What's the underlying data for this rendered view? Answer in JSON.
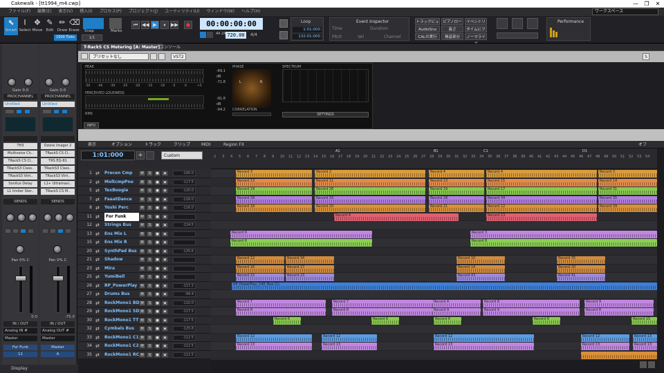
{
  "app": {
    "title": "Cakewalk - [tt1994_m4.cwp]",
    "minimize": "—",
    "maximize": "❐",
    "close": "✕"
  },
  "menu": [
    "ファイル(F)",
    "編集(E)",
    "表示(V)",
    "挿入(I)",
    "プロセス(P)",
    "プロジェクト(J)",
    "ユーティリティ(U)",
    "ウィンドウ(W)",
    "ヘルプ(H)"
  ],
  "workspace": "ワークスペース",
  "tools": [
    {
      "label": "Smart",
      "icon": "⬉"
    },
    {
      "label": "Select",
      "icon": "I"
    },
    {
      "label": "Move",
      "icon": "✥"
    },
    {
      "label": "Edit",
      "icon": "✎"
    },
    {
      "label": "Draw",
      "icon": "✏"
    },
    {
      "label": "Erase",
      "icon": "⌫"
    }
  ],
  "snap": {
    "label": "Snap",
    "value": "1/1",
    "ticks": "1500 Ticks"
  },
  "marks": {
    "label": "Marks"
  },
  "transport": {
    "time": "00:00:00:00",
    "tempo": "720.00",
    "meter": "4/4",
    "sig": "44 24"
  },
  "loop": {
    "label": "Loop",
    "start": "1:01:000",
    "end": "132:01:000"
  },
  "inspector": {
    "title": "Event Inspector",
    "cols": [
      "Time",
      "Duration"
    ],
    "cols2": [
      "Pitch",
      "Vel",
      "Channel"
    ]
  },
  "jump_buttons": [
    "トラックビュー",
    "ピアノロー",
    "イベントリ",
    "AudioSna",
    "長さ",
    "タイムにフ",
    "CALの実行",
    "無音部分",
    "ノーマライズ"
  ],
  "performance": {
    "label": "Performance"
  },
  "strips": [
    {
      "gain": "Gain 0.0",
      "pan": "Pan",
      "pc": "PROCHANNEL",
      "preset": "Untitled",
      "fx": [
        "TH3",
        "Multivoice Ch..",
        "TRackS CS Cl..",
        "TRackS3 Class..",
        "TRackS3 Vint..",
        "Sonitus Delay",
        "L1 limiter Ster.."
      ],
      "sends": "SENDS",
      "panval": "Pan 0% C",
      "io": "IN / OUT",
      "in": "Analog IN #",
      "out": "Master",
      "name": "For Funk",
      "num": "11",
      "vol": "0.0"
    },
    {
      "gain": "Gain 0.0",
      "pan": "Pan",
      "pc": "PROCHANNEL",
      "preset": "Untitled",
      "fx": [
        "Ozone Imager 2",
        "TRackS CS Cl..",
        "TRS EQ-81",
        "TRackS3 Class..",
        "TRackS3 Vint..",
        "L1+ Ultramaxi..",
        "TRackS CS M.."
      ],
      "sends": "SENDS",
      "panval": "Pan 0% C",
      "io": "IN / OUT",
      "in": "Analog OUT #",
      "out": "Master",
      "name": "Master",
      "num": "A",
      "vol": "-75.0"
    }
  ],
  "display_label": "Display",
  "tabs": [
    "T-RackS CS Metering [A: Master]",
    "コンソール"
  ],
  "plugin": {
    "preset": "プリセットなし",
    "format": "VST2",
    "peak": "PEAK",
    "loud": "PERCEIVED LOUDNESS",
    "rms": "RMS",
    "phase": "PHASE",
    "spectrum": "SPECTRUM",
    "corr": "CORRELATION",
    "settings": "SETTINGS",
    "info": "INFO",
    "db": "dB",
    "pk1": "-69.1",
    "pk2": "-71.8",
    "rm1": "-91.8",
    "rm2": "-94.2",
    "scale": [
      "-50",
      "-40",
      "-30",
      "-25",
      "-20",
      "-15",
      "-10",
      "-5",
      "0",
      "+5"
    ]
  },
  "trackmenu": [
    "表示",
    "オプション",
    "トラック",
    "クリップ",
    "MIDI",
    "Region FX"
  ],
  "trackhead": {
    "position": "1:01:000",
    "mode": "Custom",
    "off": "オフ"
  },
  "ruler": [
    "2",
    "3",
    "4",
    "5",
    "6",
    "7",
    "8",
    "9",
    "10",
    "11",
    "12",
    "13",
    "14",
    "15",
    "16",
    "17",
    "18",
    "19",
    "20",
    "21",
    "22",
    "23",
    "24",
    "25",
    "26",
    "27",
    "28",
    "29",
    "30",
    "31",
    "32",
    "33",
    "34",
    "35",
    "36",
    "37",
    "38",
    "39",
    "40",
    "41",
    "42",
    "43",
    "44",
    "45",
    "46",
    "47",
    "48",
    "49",
    "50",
    "51",
    "52",
    "53",
    "54"
  ],
  "ruler_marks": [
    "A1",
    "B1",
    "C1",
    "D1"
  ],
  "tracks": [
    {
      "num": "1",
      "name": "Precen Cmp",
      "vol": "-100.0"
    },
    {
      "num": "2",
      "name": "MoltcmpPno",
      "vol": "-117.5"
    },
    {
      "num": "5",
      "name": "TexBoogie",
      "vol": "-120.0"
    },
    {
      "num": "7",
      "name": "FaaatDance",
      "vol": "-116.0"
    },
    {
      "num": "8",
      "name": "Yoshi Perc",
      "vol": "-116.0"
    },
    {
      "num": "11",
      "name": "For Funk",
      "vol": ""
    },
    {
      "num": "12",
      "name": "Strings Bus",
      "vol": "-124.5"
    },
    {
      "num": "13",
      "name": "Ens Mix L",
      "vol": ""
    },
    {
      "num": "15",
      "name": "Ens Mix R",
      "vol": ""
    },
    {
      "num": "20",
      "name": "SynthPad Bus",
      "vol": "-125.6"
    },
    {
      "num": "21",
      "name": "Shadow",
      "vol": ""
    },
    {
      "num": "23",
      "name": "Mira",
      "vol": ""
    },
    {
      "num": "25",
      "name": "YumiBell",
      "vol": ""
    },
    {
      "num": "26",
      "name": "RP_PowerPlay",
      "vol": "-117.2"
    },
    {
      "num": "27",
      "name": "Drums Bus",
      "vol": "-94.4"
    },
    {
      "num": "28",
      "name": "RockMono1 BD",
      "vol": "-110.0"
    },
    {
      "num": "29",
      "name": "RockMono1 SD",
      "vol": "-117.5"
    },
    {
      "num": "30",
      "name": "RockMono1 TT",
      "vol": "-117.5"
    },
    {
      "num": "32",
      "name": "Cymbals Bus",
      "vol": "-125.8"
    },
    {
      "num": "33",
      "name": "RockMono1 C1",
      "vol": "-112.5"
    },
    {
      "num": "34",
      "name": "RockMono1 C2",
      "vol": "-112.5"
    },
    {
      "num": "35",
      "name": "RockMono1 RC",
      "vol": "-112.5"
    }
  ],
  "clips": [
    {
      "lane": 0,
      "color": "#d99b3c",
      "items": [
        [
          "Record 3",
          36,
          110
        ],
        [
          "Record 2",
          150,
          160
        ],
        [
          "Record 4",
          315,
          80
        ],
        [
          "Record 4",
          398,
          160
        ],
        [
          "Record 3",
          560,
          90
        ]
      ]
    },
    {
      "lane": 1,
      "color": "#e38c4a",
      "items": [
        [
          "Record 13",
          36,
          110
        ],
        [
          "Record 11",
          150,
          160
        ],
        [
          "Record 13",
          315,
          80
        ],
        [
          "Record 15",
          398,
          160
        ],
        [
          "Record 14",
          560,
          90
        ]
      ]
    },
    {
      "lane": 2,
      "color": "#88c84f",
      "items": [
        [
          "Record 19",
          36,
          110
        ],
        [
          "Record 26",
          150,
          160
        ],
        [
          "Record 19",
          315,
          80
        ],
        [
          "Record 17",
          398,
          160
        ],
        [
          "Record 31",
          560,
          90
        ]
      ]
    },
    {
      "lane": 3,
      "color": "#b07ee0",
      "items": [
        [
          "Record 28",
          36,
          110
        ],
        [
          "Record 33",
          150,
          160
        ],
        [
          "Record 28",
          315,
          80
        ],
        [
          "Record 34",
          398,
          160
        ],
        [
          "Record 35",
          560,
          90
        ]
      ]
    },
    {
      "lane": 4,
      "color": "#d9903a",
      "items": [
        [
          "Record 18",
          36,
          110
        ],
        [
          "Record 20",
          150,
          160
        ],
        [
          "Record 21",
          315,
          80
        ],
        [
          "Record 12",
          398,
          160
        ],
        [
          "Record 29",
          560,
          90
        ]
      ]
    },
    {
      "lane": 5,
      "color": "#e06070",
      "items": [
        [
          "Record 4",
          178,
          180
        ],
        [
          "Record 13",
          398,
          160
        ]
      ]
    },
    {
      "lane": 7,
      "color": "#c087e0",
      "items": [
        [
          "Record 6",
          28,
          205
        ],
        [
          "Record 3",
          375,
          270
        ]
      ]
    },
    {
      "lane": 8,
      "color": "#8ccf55",
      "items": [
        [
          "Record 6",
          28,
          205
        ],
        [
          "Record 8",
          375,
          270
        ]
      ]
    },
    {
      "lane": 10,
      "color": "#d08b3f",
      "items": [
        [
          "Record 12",
          36,
          70
        ],
        [
          "Record 34",
          108,
          70
        ],
        [
          "Record 10",
          355,
          70
        ],
        [
          "Record 35",
          500,
          70
        ]
      ]
    },
    {
      "lane": 11,
      "color": "#d08b3f",
      "items": [
        [
          "Record 16",
          36,
          70
        ],
        [
          "Record 17",
          108,
          70
        ],
        [
          "Record 14",
          355,
          70
        ],
        [
          "Record 20",
          500,
          70
        ]
      ]
    },
    {
      "lane": 12,
      "color": "#9b8ad8",
      "items": [
        [
          "Record 22",
          36,
          70
        ],
        [
          "Record 23",
          108,
          70
        ],
        [
          "Record 43",
          355,
          70
        ],
        [
          "Record 41",
          500,
          70
        ]
      ]
    },
    {
      "lane": 13,
      "color": "#3d7fd8",
      "items": [
        [
          "RP_PowerPlay_140_Bus (1)",
          30,
          615
        ]
      ]
    },
    {
      "lane": 15,
      "color": "#c087e0",
      "items": [
        [
          "Record 7",
          36,
          130
        ],
        [
          "Record 7",
          175,
          145
        ],
        [
          "Record 4",
          320,
          70
        ],
        [
          "Record 8",
          393,
          140
        ],
        [
          "Record 9",
          540,
          100
        ]
      ]
    },
    {
      "lane": 16,
      "color": "#c087e0",
      "items": [
        [
          "Record 8",
          36,
          130
        ],
        [
          "Record 8",
          175,
          145
        ],
        [
          "Record 9",
          320,
          70
        ],
        [
          "Record 9",
          393,
          140
        ],
        [
          "Record 8",
          540,
          100
        ]
      ]
    },
    {
      "lane": 17,
      "color": "#88c84f",
      "items": [
        [
          "Record 6",
          90,
          40
        ],
        [
          "Record 6",
          232,
          40
        ],
        [
          "Record 6",
          322,
          40
        ],
        [
          "Record 6",
          465,
          40
        ],
        [
          "Record 15",
          608,
          37
        ]
      ]
    },
    {
      "lane": 19,
      "color": "#5b9be0",
      "items": [
        [
          "Record 12",
          36,
          110
        ],
        [
          "Record 12",
          160,
          80
        ],
        [
          "Record 12",
          322,
          145
        ],
        [
          "Record 12",
          535,
          70
        ],
        [
          "Record 13",
          610,
          35
        ]
      ]
    },
    {
      "lane": 20,
      "color": "#c087e0",
      "items": [
        [
          "Record 13",
          36,
          110
        ],
        [
          "Record 13",
          160,
          80
        ],
        [
          "Record 13",
          322,
          145
        ],
        [
          "Record 13",
          535,
          70
        ],
        [
          "Record 13",
          610,
          35
        ]
      ]
    },
    {
      "lane": 21,
      "color": "#d9903a",
      "items": [
        [
          "",
          535,
          110
        ]
      ]
    }
  ]
}
